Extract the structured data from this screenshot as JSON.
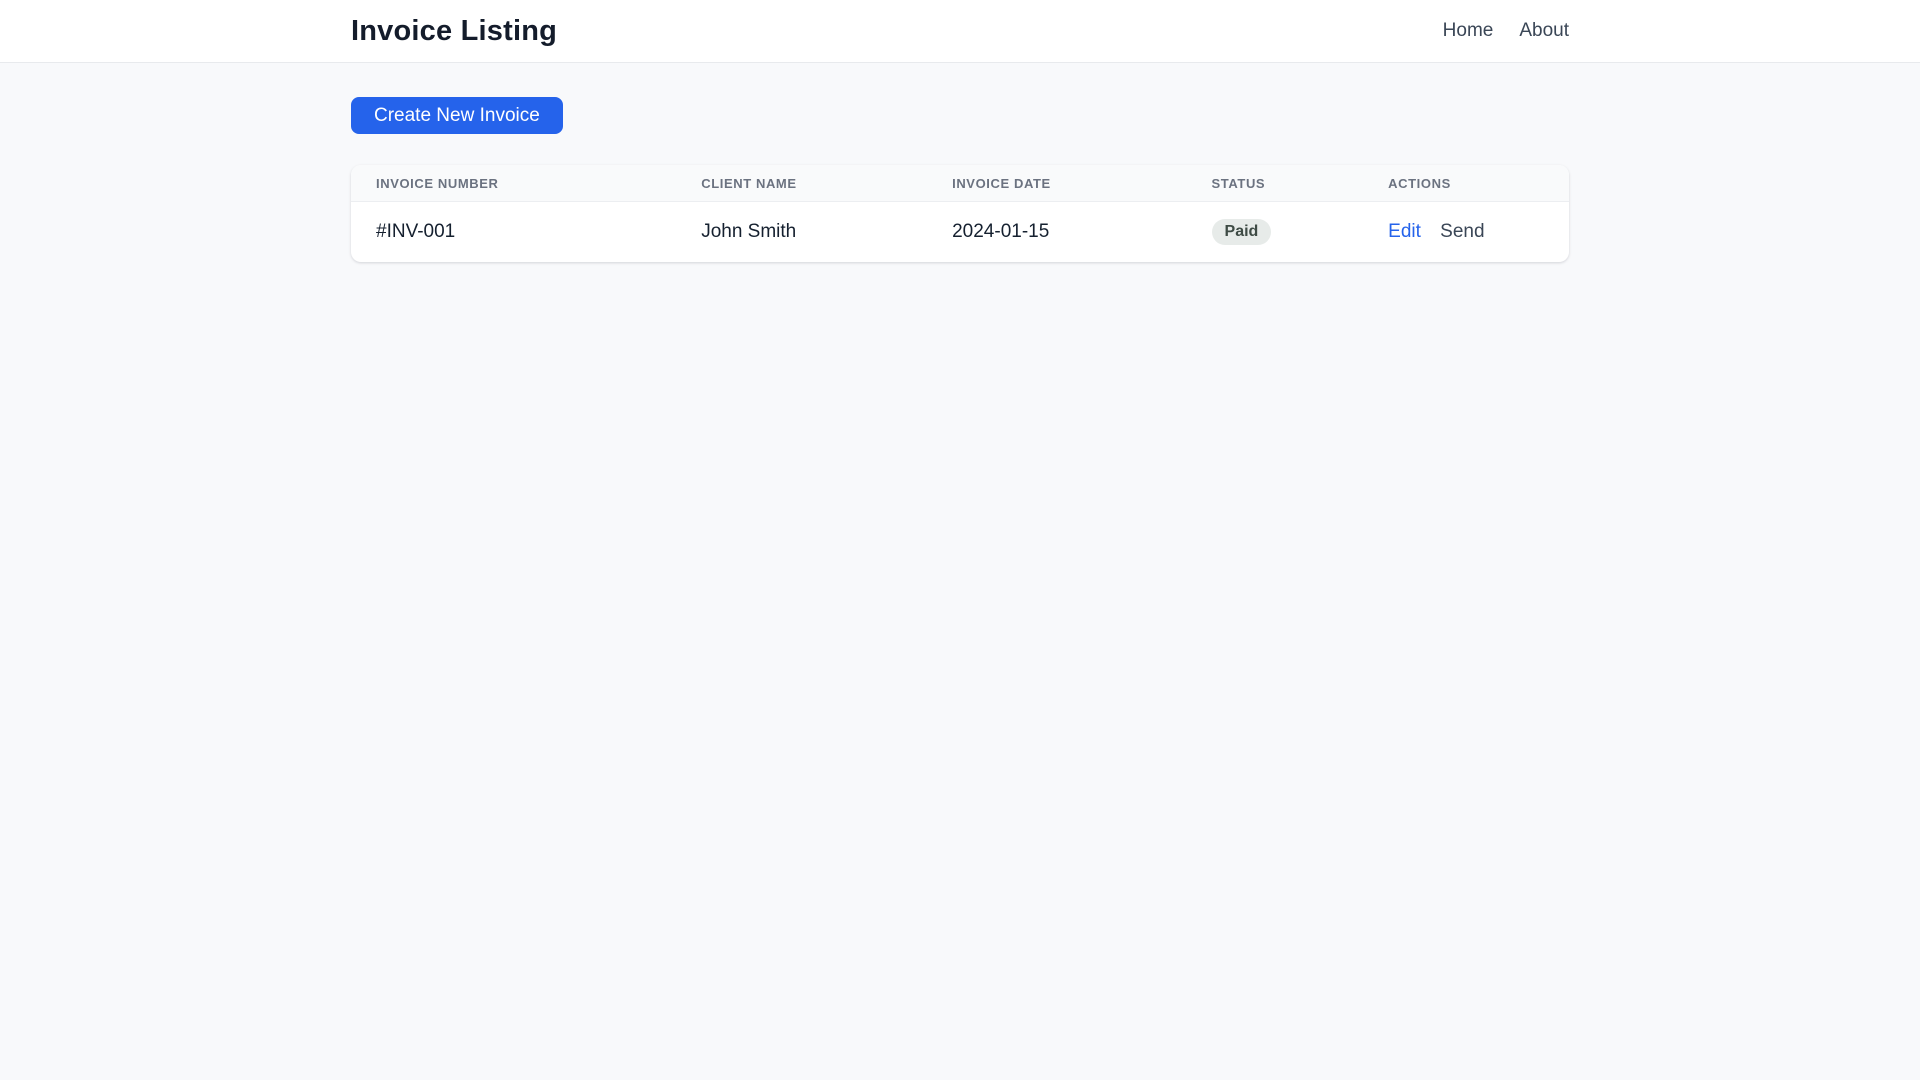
{
  "header": {
    "title": "Invoice Listing",
    "nav": [
      {
        "label": "Home"
      },
      {
        "label": "About"
      }
    ]
  },
  "toolbar": {
    "create_button_label": "Create New Invoice"
  },
  "table": {
    "columns": [
      "INVOICE NUMBER",
      "CLIENT NAME",
      "INVOICE DATE",
      "STATUS",
      "ACTIONS"
    ],
    "rows": [
      {
        "invoice_number": "#INV-001",
        "client_name": "John Smith",
        "invoice_date": "2024-01-15",
        "status": "Paid",
        "actions": {
          "edit": "Edit",
          "send": "Send"
        }
      }
    ]
  },
  "colors": {
    "accent_blue": "#2563eb",
    "page_background": "#f8f9fb",
    "badge_background": "#e7ebe9",
    "badge_text": "#3e4b45"
  }
}
